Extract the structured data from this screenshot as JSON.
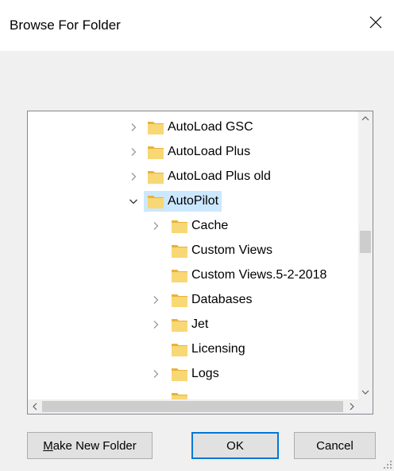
{
  "window": {
    "title": "Browse For Folder",
    "close_icon": "close-icon"
  },
  "colors": {
    "folder": "#f8d775",
    "folder_dark": "#e8b23a",
    "selection": "#cce8ff",
    "default_button_border": "#0078d7"
  },
  "tree": {
    "items": [
      {
        "label": "AutoLoad GSC",
        "level": 0,
        "expander": "collapsed",
        "selected": false
      },
      {
        "label": "AutoLoad Plus",
        "level": 0,
        "expander": "collapsed",
        "selected": false
      },
      {
        "label": "AutoLoad Plus old",
        "level": 0,
        "expander": "collapsed",
        "selected": false
      },
      {
        "label": "AutoPilot",
        "level": 0,
        "expander": "expanded",
        "selected": true
      },
      {
        "label": "Cache",
        "level": 1,
        "expander": "collapsed",
        "selected": false
      },
      {
        "label": "Custom Views",
        "level": 1,
        "expander": "none",
        "selected": false
      },
      {
        "label": "Custom Views.5-2-2018",
        "level": 1,
        "expander": "none",
        "selected": false
      },
      {
        "label": "Databases",
        "level": 1,
        "expander": "collapsed",
        "selected": false
      },
      {
        "label": "Jet",
        "level": 1,
        "expander": "collapsed",
        "selected": false
      },
      {
        "label": "Licensing",
        "level": 1,
        "expander": "none",
        "selected": false
      },
      {
        "label": "Logs",
        "level": 1,
        "expander": "collapsed",
        "selected": false
      },
      {
        "label": "",
        "level": 1,
        "expander": "none",
        "selected": false
      }
    ]
  },
  "buttons": {
    "make_new_folder_mnemonic": "M",
    "make_new_folder_rest": "ake New Folder",
    "ok": "OK",
    "cancel": "Cancel"
  }
}
